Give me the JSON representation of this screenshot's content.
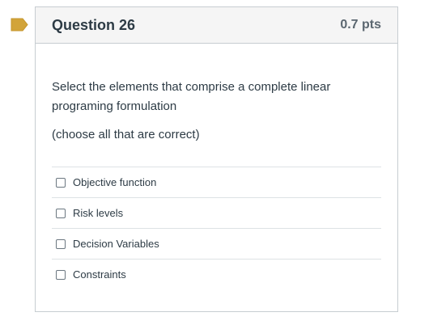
{
  "question": {
    "title": "Question 26",
    "points": "0.7 pts",
    "prompt": "Select the elements that comprise a complete linear programing formulation",
    "hint": "(choose all that are correct)",
    "flag_color": "#d2a43a"
  },
  "answers": [
    {
      "label": "Objective function",
      "checked": false
    },
    {
      "label": "Risk levels",
      "checked": false
    },
    {
      "label": "Decision Variables",
      "checked": false
    },
    {
      "label": "Constraints",
      "checked": false
    }
  ]
}
